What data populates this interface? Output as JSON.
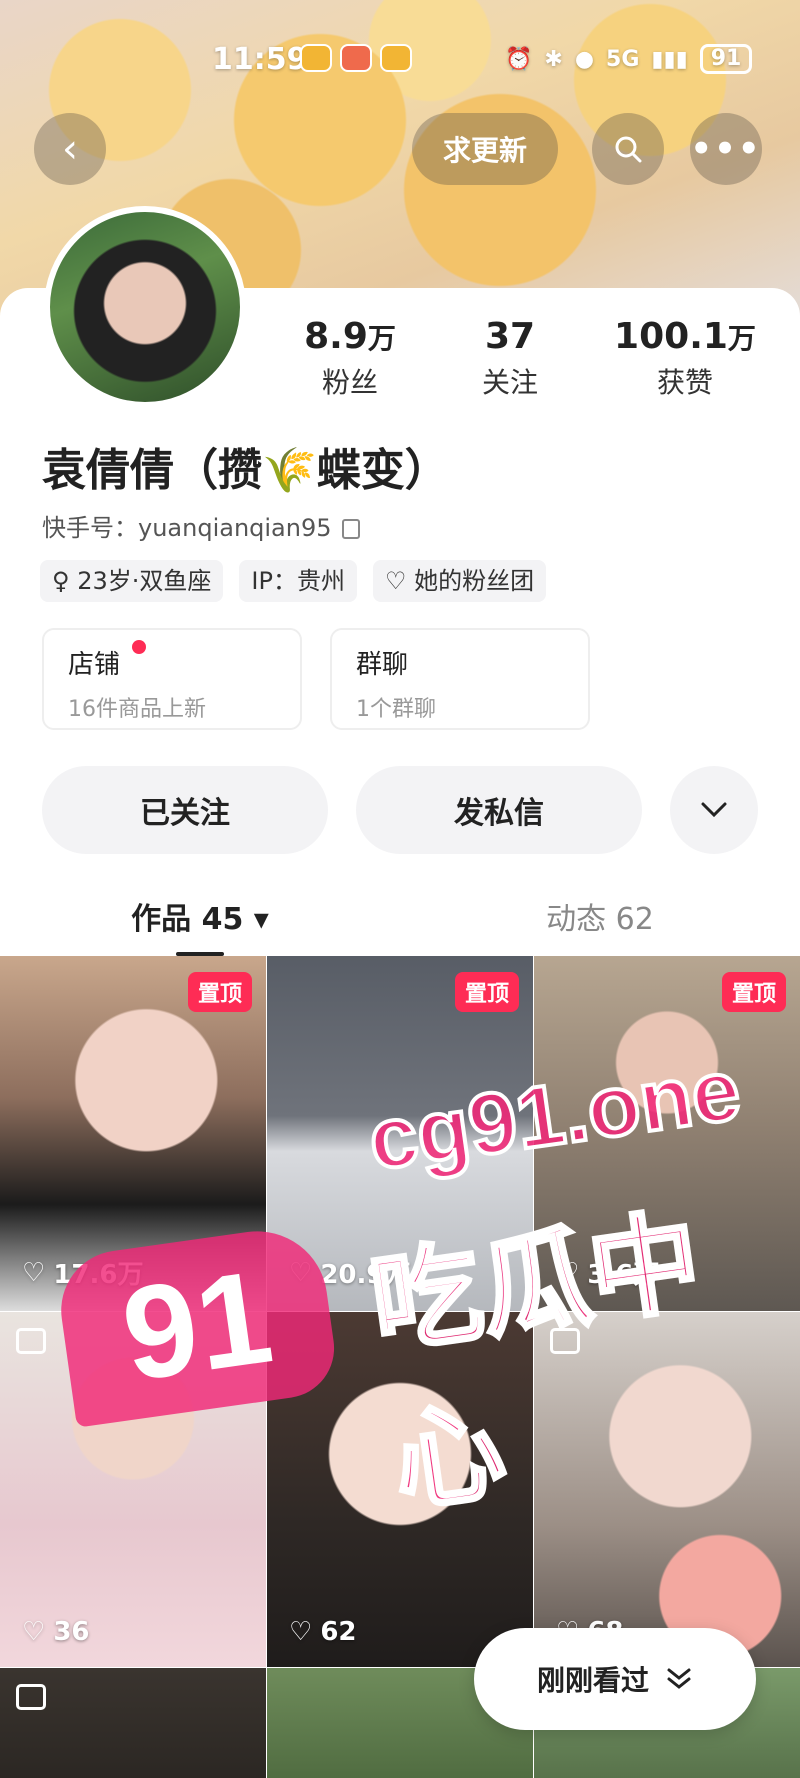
{
  "status_bar": {
    "time": "11:59",
    "battery": "91",
    "network": "5G"
  },
  "nav": {
    "update_label": "求更新"
  },
  "profile": {
    "name": "袁倩倩（攒🌾蝶变）",
    "kuaishou_id_label": "快手号：",
    "kuaishou_id": "yuanqianqian95",
    "stats": [
      {
        "value": "8.9",
        "unit": "万",
        "label": "粉丝"
      },
      {
        "value": "37",
        "unit": "",
        "label": "关注"
      },
      {
        "value": "100.1",
        "unit": "万",
        "label": "获赞"
      }
    ],
    "tags": [
      {
        "icon": "gender-female-icon",
        "text": "23岁·双鱼座"
      },
      {
        "icon": "",
        "text": "IP：贵州"
      },
      {
        "icon": "fan-group-icon",
        "text": "她的粉丝团"
      }
    ],
    "boxes": [
      {
        "title": "店铺",
        "subtitle": "16件商品上新",
        "dot": true
      },
      {
        "title": "群聊",
        "subtitle": "1个群聊",
        "dot": false
      }
    ],
    "actions": {
      "followed": "已关注",
      "message": "发私信"
    }
  },
  "tabs": [
    {
      "label": "作品 45 ▾",
      "active": true
    },
    {
      "label": "动态 62",
      "active": false
    }
  ],
  "grid": [
    {
      "pin": "置顶",
      "likes": "17.6万"
    },
    {
      "pin": "置顶",
      "likes": "20.9万"
    },
    {
      "pin": "置顶",
      "likes": "3.6万"
    },
    {
      "pin": "",
      "likes": "36"
    },
    {
      "pin": "",
      "likes": "62"
    },
    {
      "pin": "",
      "likes": "68"
    }
  ],
  "watermark": {
    "number": "91",
    "url": "cg91.one",
    "text": "吃瓜中心"
  },
  "float_button": {
    "label": "刚刚看过"
  },
  "colors": {
    "accent": "#fe2c55",
    "watermark": "#f02878"
  }
}
